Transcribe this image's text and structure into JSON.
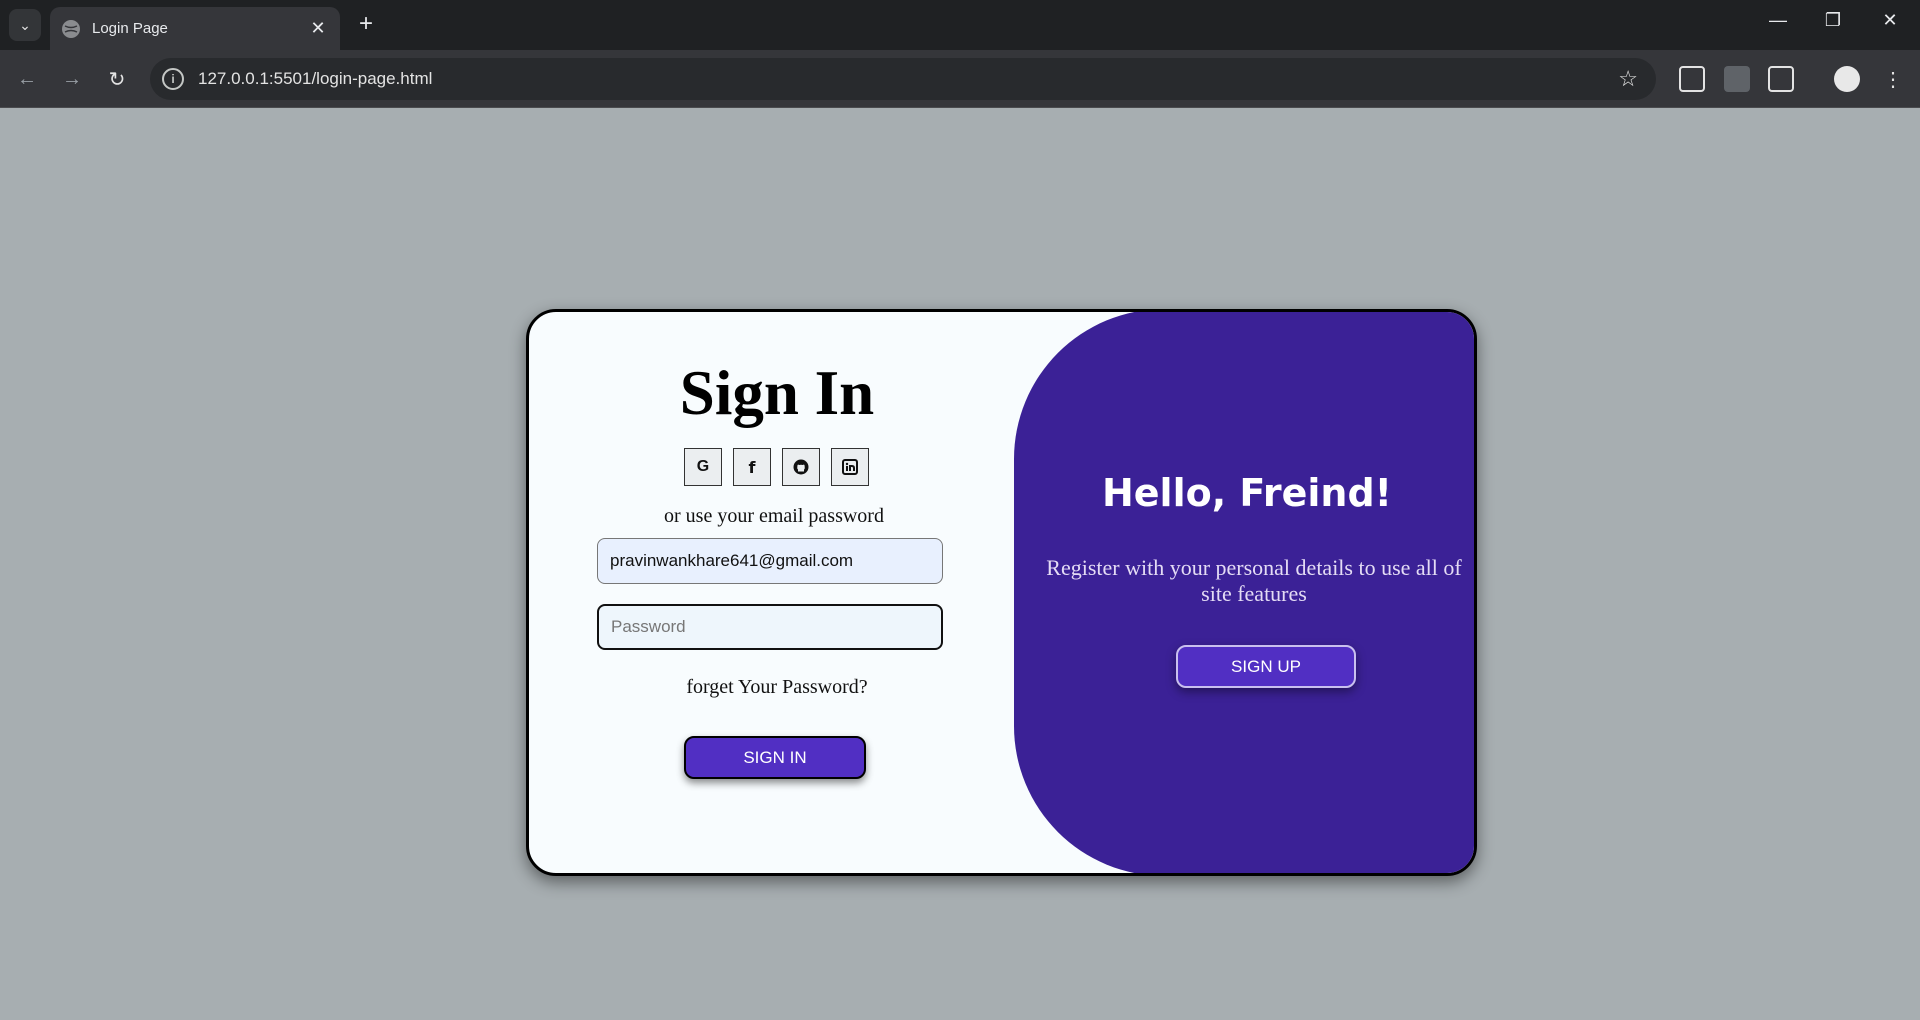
{
  "browser": {
    "tab_title": "Login Page",
    "url": "127.0.0.1:5501/login-page.html"
  },
  "signin": {
    "title": "Sign In",
    "socials": [
      {
        "icon": "google-icon",
        "glyph": "G"
      },
      {
        "icon": "facebook-icon",
        "glyph": "f"
      },
      {
        "icon": "github-icon",
        "glyph": "github"
      },
      {
        "icon": "linkedin-icon",
        "glyph": "in"
      }
    ],
    "or_text": "or use your email password",
    "email_value": "pravinwankhare641@gmail.com",
    "password_placeholder": "Password",
    "forget_text": "forget Your Password?",
    "button_label": "SIGN IN"
  },
  "panel": {
    "heading": "Hello, Freind!",
    "text": "Register with your personal details to use all of site features",
    "button_label": "SIGN UP"
  },
  "colors": {
    "accent": "#512fc3",
    "panel_bg": "#3b2196",
    "page_bg": "#a7aeb1"
  }
}
